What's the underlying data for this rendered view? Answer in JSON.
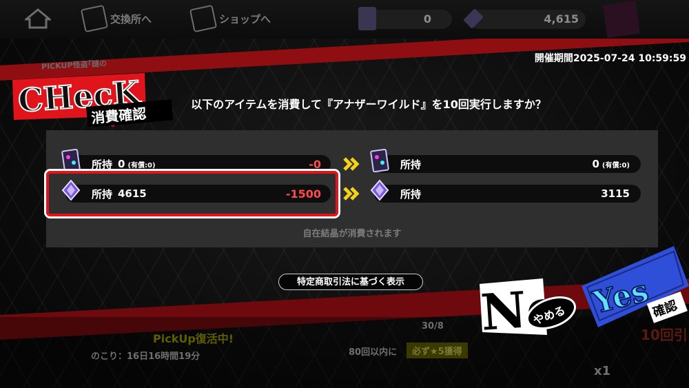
{
  "topbar": {
    "exchange_label": "交換所へ",
    "shop_label": "ショップへ",
    "currency_paid_value": "0",
    "currency_free_value": "4,615"
  },
  "event": {
    "period_text": "開催期間2025-07-24 10:59:59",
    "pickup_tag": "PICKUP怪盗｢謎の",
    "pickup_banner": "PickUp復活中!",
    "remaining": "のこり：16日16時間19分",
    "guarantee": "80回以内に",
    "guarantee_badge": "必ず★5獲得",
    "counter_hint": "30/8",
    "ten_pull": "10回引",
    "ticket_count": "x1"
  },
  "dialog": {
    "logo_text": "CHecK",
    "logo_sub": "消費確認",
    "message": "以下のアイテムを消費して『アナザーワイルド』を10回実行しますか？",
    "rows": [
      {
        "label": "所持",
        "before": "0",
        "before_sub": "(有償:0)",
        "delta": "-0",
        "after_label": "所持",
        "after": "0",
        "after_sub": "(有償:0)"
      },
      {
        "label": "所持",
        "before": "4615",
        "delta": "-1500",
        "after_label": "所持",
        "after": "3115"
      }
    ],
    "note": "自在結晶が消費されます",
    "law_button": "特定商取引法に基づく表示",
    "no_main": "No",
    "no_sub": "やめる",
    "yes_main": "Yes",
    "yes_sub": "確認"
  },
  "colors": {
    "accent_red": "#e0141b",
    "delta_red": "#ff4a4a",
    "arrow_yellow": "#f5d21a",
    "yes_blue": "#2f4fd8",
    "yes_cyan": "#5fe0ff"
  }
}
